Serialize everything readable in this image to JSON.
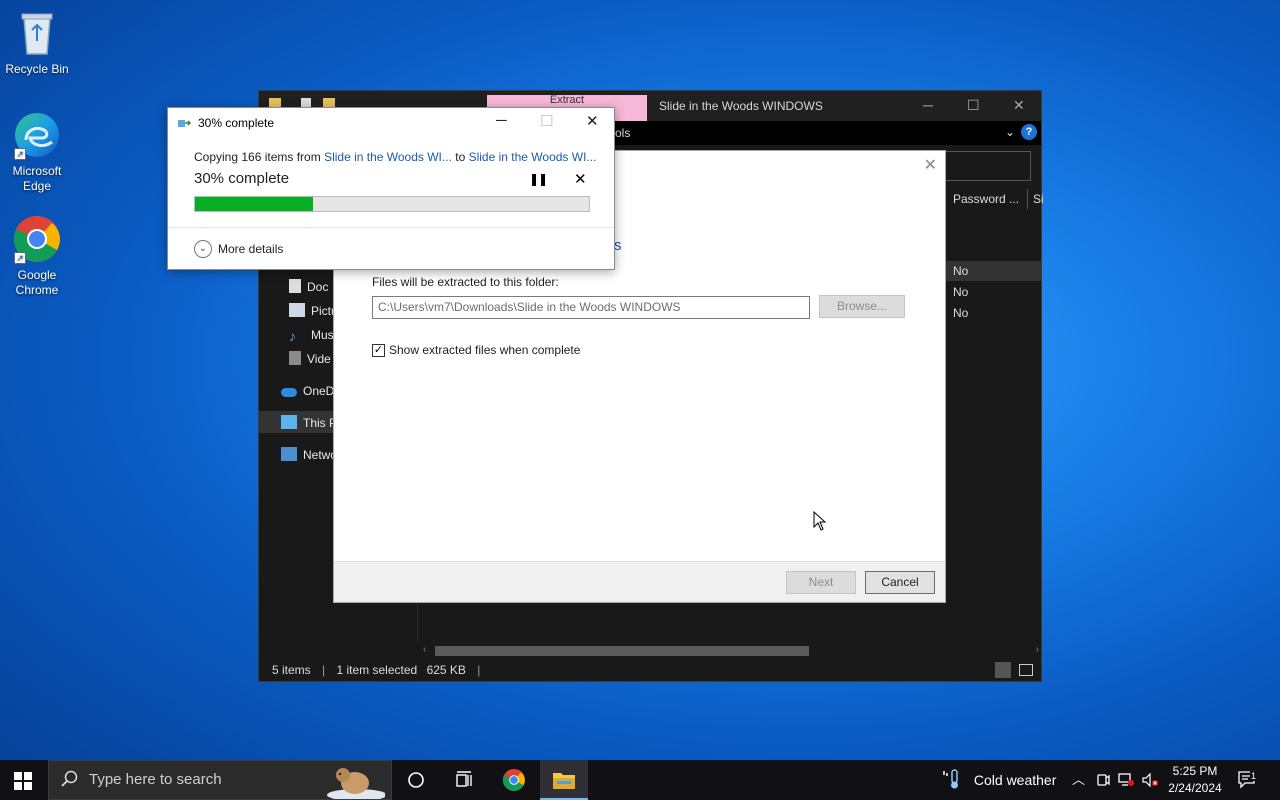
{
  "desktop": {
    "icons": [
      {
        "label": "Recycle Bin"
      },
      {
        "label": "Microsoft Edge"
      },
      {
        "label": "Google Chrome"
      }
    ]
  },
  "explorer": {
    "tab_label": "Extract",
    "title": "Slide in the Woods WINDOWS",
    "ribbon_tools": "ols",
    "help": "?",
    "columns": {
      "password": "Password ...",
      "size": "Si"
    },
    "rows": [
      "No",
      "No",
      "No"
    ],
    "nav": [
      {
        "label": "Doc"
      },
      {
        "label": "Pictu"
      },
      {
        "label": "Mus"
      },
      {
        "label": "Vide"
      },
      {
        "label": "OneD"
      },
      {
        "label": "This P"
      },
      {
        "label": "Netwo"
      }
    ],
    "status": {
      "items": "5 items",
      "selected": "1 item selected",
      "size": "625 KB"
    }
  },
  "wizard": {
    "partial_heading": "s",
    "folder_label": "Files will be extracted to this folder:",
    "path_value": "C:\\Users\\vm7\\Downloads\\Slide in the Woods WINDOWS",
    "browse_label": "Browse...",
    "show_files_label": "Show extracted files when complete",
    "show_files_checked": true,
    "next_label": "Next",
    "cancel_label": "Cancel"
  },
  "progress": {
    "title": "30% complete",
    "copy_prefix": "Copying 166 items from ",
    "source": "Slide in the Woods WI...",
    "to_word": " to ",
    "destination": "Slide in the Woods WI...",
    "percent_text": "30% complete",
    "percent": 30,
    "bar_color": "#06b025",
    "more_details": "More details"
  },
  "taskbar": {
    "search_placeholder": "Type here to search",
    "weather": "Cold weather",
    "time": "5:25 PM",
    "date": "2/24/2024",
    "notifications": "1"
  }
}
